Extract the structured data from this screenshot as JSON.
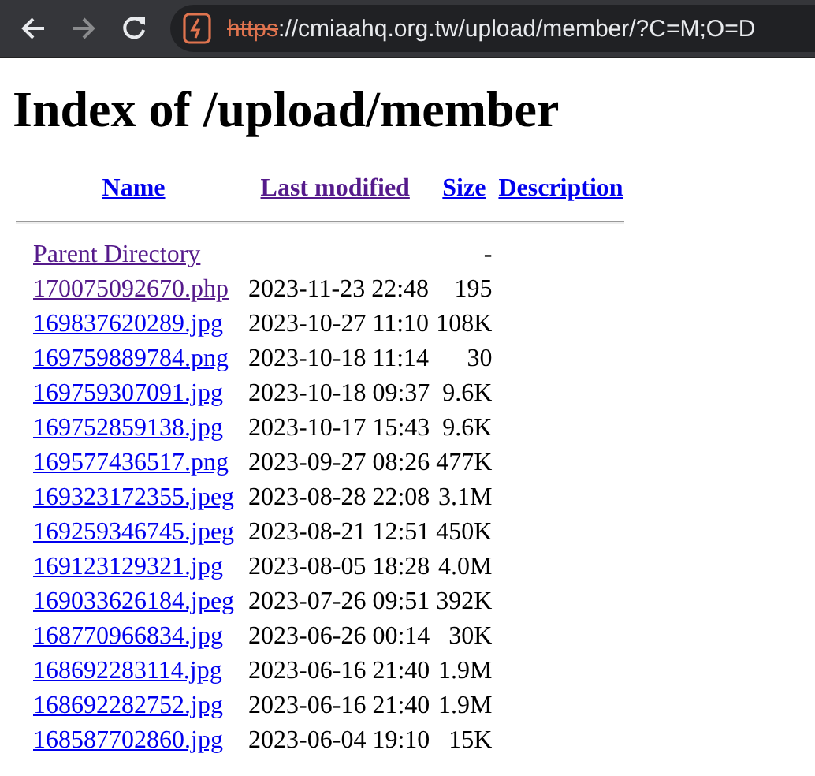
{
  "browser": {
    "url_scheme": "https",
    "url_rest": "://cmiaahq.org.tw/upload/member/?C=M;O=D",
    "insecure": true
  },
  "title": "Index of /upload/member",
  "table": {
    "columns": [
      {
        "label": "Name",
        "visited": false
      },
      {
        "label": "Last modified",
        "visited": true
      },
      {
        "label": "Size",
        "visited": false
      },
      {
        "label": "Description",
        "visited": false
      }
    ],
    "rows": [
      {
        "name": "Parent Directory",
        "modified": "",
        "size": "-",
        "visited": true
      },
      {
        "name": "170075092670.php",
        "modified": "2023-11-23 22:48",
        "size": "195",
        "visited": true
      },
      {
        "name": "169837620289.jpg",
        "modified": "2023-10-27 11:10",
        "size": "108K",
        "visited": false
      },
      {
        "name": "169759889784.png",
        "modified": "2023-10-18 11:14",
        "size": "30",
        "visited": false
      },
      {
        "name": "169759307091.jpg",
        "modified": "2023-10-18 09:37",
        "size": "9.6K",
        "visited": false
      },
      {
        "name": "169752859138.jpg",
        "modified": "2023-10-17 15:43",
        "size": "9.6K",
        "visited": false
      },
      {
        "name": "169577436517.png",
        "modified": "2023-09-27 08:26",
        "size": "477K",
        "visited": false
      },
      {
        "name": "169323172355.jpeg",
        "modified": "2023-08-28 22:08",
        "size": "3.1M",
        "visited": false
      },
      {
        "name": "169259346745.jpeg",
        "modified": "2023-08-21 12:51",
        "size": "450K",
        "visited": false
      },
      {
        "name": "169123129321.jpg",
        "modified": "2023-08-05 18:28",
        "size": "4.0M",
        "visited": false
      },
      {
        "name": "169033626184.jpeg",
        "modified": "2023-07-26 09:51",
        "size": "392K",
        "visited": false
      },
      {
        "name": "168770966834.jpg",
        "modified": "2023-06-26 00:14",
        "size": "30K",
        "visited": false
      },
      {
        "name": "168692283114.jpg",
        "modified": "2023-06-16 21:40",
        "size": "1.9M",
        "visited": false
      },
      {
        "name": "168692282752.jpg",
        "modified": "2023-06-16 21:40",
        "size": "1.9M",
        "visited": false
      },
      {
        "name": "168587702860.jpg",
        "modified": "2023-06-04 19:10",
        "size": "15K",
        "visited": false
      }
    ]
  }
}
